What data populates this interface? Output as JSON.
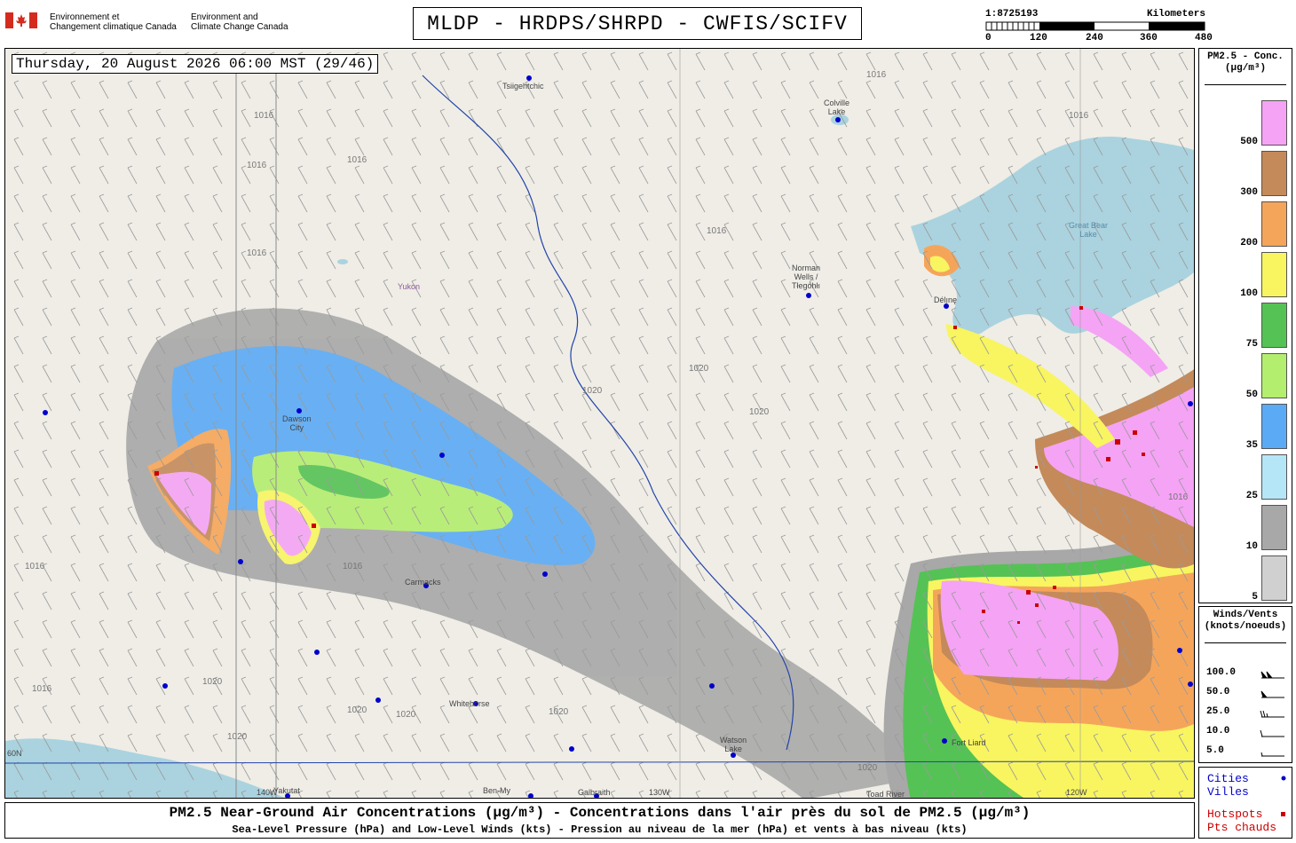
{
  "header": {
    "dept_fr": [
      "Environnement et",
      "Changement climatique Canada"
    ],
    "dept_en": [
      "Environment and",
      "Climate Change Canada"
    ],
    "title": "MLDP - HRDPS/SHRPD - CWFIS/SCIFV"
  },
  "scale": {
    "ratio": "1:8725193",
    "units": "Kilometers",
    "ticks": [
      "0",
      "120",
      "240",
      "360",
      "480"
    ]
  },
  "map": {
    "datetime": "Thursday, 20 August 2026 06:00 MST (29/46)",
    "places": [
      {
        "name": "Tsiigehtchic"
      },
      {
        "name": "Colville\nLake"
      },
      {
        "name": "Great Bear\nLake"
      },
      {
        "name": "Norman\nWells /\nTłegóhłı"
      },
      {
        "name": "Délı̨nę"
      },
      {
        "name": "Yukon"
      },
      {
        "name": "Dawson\nCity"
      },
      {
        "name": "Carmacks"
      },
      {
        "name": "Whitehorse"
      },
      {
        "name": "Watson\nLake"
      },
      {
        "name": "Fort Liard"
      },
      {
        "name": "Yakutat"
      },
      {
        "name": "Ben-My"
      },
      {
        "name": "Galbraith"
      },
      {
        "name": "Toad River"
      },
      {
        "name": "130W"
      },
      {
        "name": "120W"
      },
      {
        "name": "60N"
      },
      {
        "name": "140W"
      }
    ],
    "isobars": [
      "1016",
      "1016",
      "1016",
      "1016",
      "1016",
      "1016",
      "1016",
      "1020",
      "1020",
      "1020",
      "1020",
      "1020",
      "1016",
      "1016",
      "1016",
      "1020",
      "1020",
      "1020",
      "1020",
      "1016"
    ],
    "colors": {
      "land": "#efede6",
      "water": "#aad3df",
      "fire_hotspot": "#cc0000",
      "city_dot": "#0000cc"
    }
  },
  "legend": {
    "title": [
      "PM2.5 - Conc.",
      "(µg/m³)"
    ],
    "levels": [
      {
        "label": "500",
        "color": "#f5a3f5"
      },
      {
        "label": "300",
        "color": "#c48a5a"
      },
      {
        "label": "200",
        "color": "#f5a55a"
      },
      {
        "label": "100",
        "color": "#f8f560"
      },
      {
        "label": "75",
        "color": "#55c255"
      },
      {
        "label": "50",
        "color": "#b4ee6e"
      },
      {
        "label": "35",
        "color": "#5aaaf5"
      },
      {
        "label": "25",
        "color": "#b4e6f8"
      },
      {
        "label": "10",
        "color": "#a8a8a8"
      },
      {
        "label": "5",
        "color": "#d0d0d0"
      }
    ]
  },
  "winds": {
    "title": [
      "Winds/Vents",
      "(knots/noeuds)"
    ],
    "rows": [
      {
        "label": "100.0",
        "glyph": "pennant-2"
      },
      {
        "label": "50.0",
        "glyph": "pennant"
      },
      {
        "label": "25.0",
        "glyph": "barb-2.5"
      },
      {
        "label": "10.0",
        "glyph": "barb-1"
      },
      {
        "label": "5.0",
        "glyph": "half-barb"
      }
    ]
  },
  "key": {
    "cities": [
      "Cities",
      "Villes"
    ],
    "hotspots": [
      "Hotspots",
      "Pts chauds"
    ],
    "cities_color": "#0000cc",
    "hotspots_color": "#cc0000"
  },
  "footer": {
    "line1": "PM2.5 Near-Ground Air Concentrations (µg/m³) - Concentrations dans l'air près du sol de PM2.5 (µg/m³)",
    "line2": "Sea-Level Pressure (hPa) and Low-Level Winds (kts) - Pression au niveau de la mer (hPa) et vents à bas niveau (kts)"
  }
}
